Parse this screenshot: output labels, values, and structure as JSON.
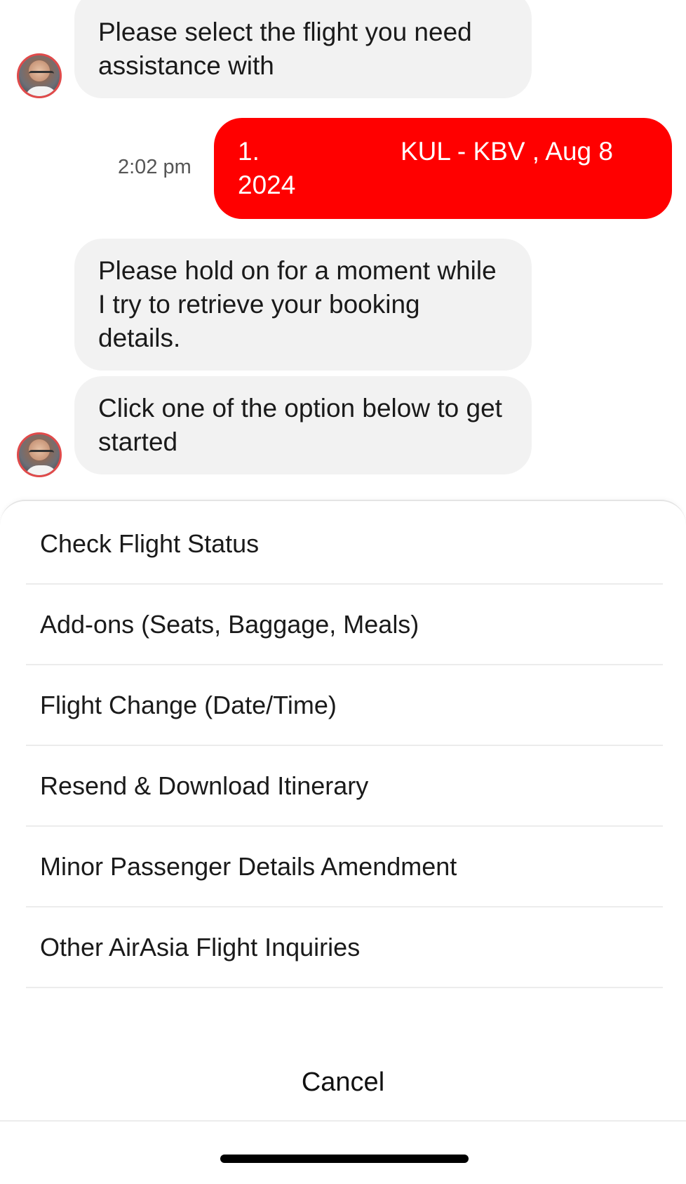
{
  "messages": {
    "m1": "Please select the flight you need assistance with",
    "m2_line1_num": "1.",
    "m2_line1_route": "KUL - KBV , Aug 8",
    "m2_line2": "2024",
    "m2_time": "2:02 pm",
    "m3": "Please hold on for a moment while I try to retrieve your booking details.",
    "m4": "Click one of the option below to get started"
  },
  "sheet": {
    "options": [
      {
        "label": "Check Flight Status"
      },
      {
        "label": "Add-ons (Seats, Baggage, Meals)"
      },
      {
        "label": "Flight Change (Date/Time)"
      },
      {
        "label": "Resend & Download Itinerary"
      },
      {
        "label": "Minor Passenger Details Amendment"
      },
      {
        "label": "Other AirAsia Flight Inquiries"
      }
    ],
    "cancel_label": "Cancel"
  },
  "colors": {
    "accent": "#ff0000",
    "bubble_in": "#f2f2f2"
  }
}
